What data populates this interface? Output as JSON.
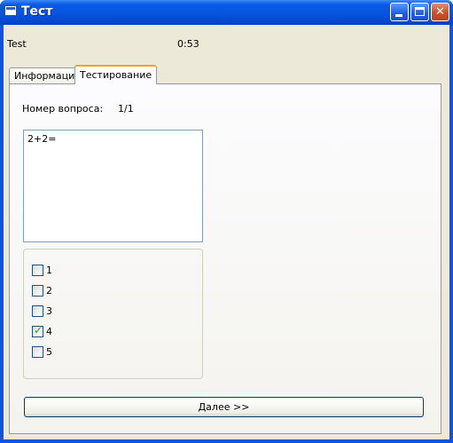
{
  "window": {
    "title": "Тест"
  },
  "status": {
    "name": "Test",
    "timer": "0:53"
  },
  "tabs": [
    {
      "label": "Информация"
    },
    {
      "label": "Тестирование"
    }
  ],
  "question": {
    "number_label": "Номер вопроса:",
    "number_value": "1/1",
    "text": "2+2="
  },
  "answers": [
    {
      "label": "1",
      "checked": false
    },
    {
      "label": "2",
      "checked": false
    },
    {
      "label": "3",
      "checked": false
    },
    {
      "label": "4",
      "checked": true
    },
    {
      "label": "5",
      "checked": false
    }
  ],
  "buttons": {
    "next": "Далее >>"
  },
  "colors": {
    "titlebar": "#0654e0",
    "tab_highlight": "#f4a320",
    "check": "#21a121"
  }
}
